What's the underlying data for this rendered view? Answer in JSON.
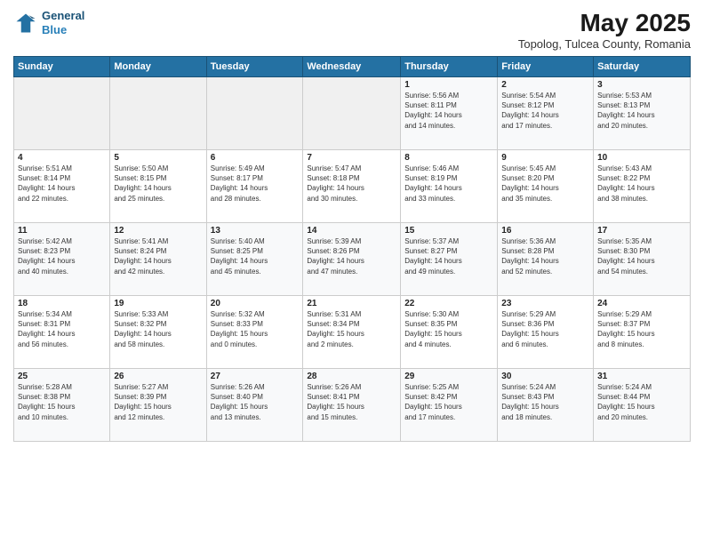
{
  "header": {
    "logo_line1": "General",
    "logo_line2": "Blue",
    "title": "May 2025",
    "subtitle": "Topolog, Tulcea County, Romania"
  },
  "weekdays": [
    "Sunday",
    "Monday",
    "Tuesday",
    "Wednesday",
    "Thursday",
    "Friday",
    "Saturday"
  ],
  "weeks": [
    [
      {
        "day": "",
        "info": ""
      },
      {
        "day": "",
        "info": ""
      },
      {
        "day": "",
        "info": ""
      },
      {
        "day": "",
        "info": ""
      },
      {
        "day": "1",
        "info": "Sunrise: 5:56 AM\nSunset: 8:11 PM\nDaylight: 14 hours\nand 14 minutes."
      },
      {
        "day": "2",
        "info": "Sunrise: 5:54 AM\nSunset: 8:12 PM\nDaylight: 14 hours\nand 17 minutes."
      },
      {
        "day": "3",
        "info": "Sunrise: 5:53 AM\nSunset: 8:13 PM\nDaylight: 14 hours\nand 20 minutes."
      }
    ],
    [
      {
        "day": "4",
        "info": "Sunrise: 5:51 AM\nSunset: 8:14 PM\nDaylight: 14 hours\nand 22 minutes."
      },
      {
        "day": "5",
        "info": "Sunrise: 5:50 AM\nSunset: 8:15 PM\nDaylight: 14 hours\nand 25 minutes."
      },
      {
        "day": "6",
        "info": "Sunrise: 5:49 AM\nSunset: 8:17 PM\nDaylight: 14 hours\nand 28 minutes."
      },
      {
        "day": "7",
        "info": "Sunrise: 5:47 AM\nSunset: 8:18 PM\nDaylight: 14 hours\nand 30 minutes."
      },
      {
        "day": "8",
        "info": "Sunrise: 5:46 AM\nSunset: 8:19 PM\nDaylight: 14 hours\nand 33 minutes."
      },
      {
        "day": "9",
        "info": "Sunrise: 5:45 AM\nSunset: 8:20 PM\nDaylight: 14 hours\nand 35 minutes."
      },
      {
        "day": "10",
        "info": "Sunrise: 5:43 AM\nSunset: 8:22 PM\nDaylight: 14 hours\nand 38 minutes."
      }
    ],
    [
      {
        "day": "11",
        "info": "Sunrise: 5:42 AM\nSunset: 8:23 PM\nDaylight: 14 hours\nand 40 minutes."
      },
      {
        "day": "12",
        "info": "Sunrise: 5:41 AM\nSunset: 8:24 PM\nDaylight: 14 hours\nand 42 minutes."
      },
      {
        "day": "13",
        "info": "Sunrise: 5:40 AM\nSunset: 8:25 PM\nDaylight: 14 hours\nand 45 minutes."
      },
      {
        "day": "14",
        "info": "Sunrise: 5:39 AM\nSunset: 8:26 PM\nDaylight: 14 hours\nand 47 minutes."
      },
      {
        "day": "15",
        "info": "Sunrise: 5:37 AM\nSunset: 8:27 PM\nDaylight: 14 hours\nand 49 minutes."
      },
      {
        "day": "16",
        "info": "Sunrise: 5:36 AM\nSunset: 8:28 PM\nDaylight: 14 hours\nand 52 minutes."
      },
      {
        "day": "17",
        "info": "Sunrise: 5:35 AM\nSunset: 8:30 PM\nDaylight: 14 hours\nand 54 minutes."
      }
    ],
    [
      {
        "day": "18",
        "info": "Sunrise: 5:34 AM\nSunset: 8:31 PM\nDaylight: 14 hours\nand 56 minutes."
      },
      {
        "day": "19",
        "info": "Sunrise: 5:33 AM\nSunset: 8:32 PM\nDaylight: 14 hours\nand 58 minutes."
      },
      {
        "day": "20",
        "info": "Sunrise: 5:32 AM\nSunset: 8:33 PM\nDaylight: 15 hours\nand 0 minutes."
      },
      {
        "day": "21",
        "info": "Sunrise: 5:31 AM\nSunset: 8:34 PM\nDaylight: 15 hours\nand 2 minutes."
      },
      {
        "day": "22",
        "info": "Sunrise: 5:30 AM\nSunset: 8:35 PM\nDaylight: 15 hours\nand 4 minutes."
      },
      {
        "day": "23",
        "info": "Sunrise: 5:29 AM\nSunset: 8:36 PM\nDaylight: 15 hours\nand 6 minutes."
      },
      {
        "day": "24",
        "info": "Sunrise: 5:29 AM\nSunset: 8:37 PM\nDaylight: 15 hours\nand 8 minutes."
      }
    ],
    [
      {
        "day": "25",
        "info": "Sunrise: 5:28 AM\nSunset: 8:38 PM\nDaylight: 15 hours\nand 10 minutes."
      },
      {
        "day": "26",
        "info": "Sunrise: 5:27 AM\nSunset: 8:39 PM\nDaylight: 15 hours\nand 12 minutes."
      },
      {
        "day": "27",
        "info": "Sunrise: 5:26 AM\nSunset: 8:40 PM\nDaylight: 15 hours\nand 13 minutes."
      },
      {
        "day": "28",
        "info": "Sunrise: 5:26 AM\nSunset: 8:41 PM\nDaylight: 15 hours\nand 15 minutes."
      },
      {
        "day": "29",
        "info": "Sunrise: 5:25 AM\nSunset: 8:42 PM\nDaylight: 15 hours\nand 17 minutes."
      },
      {
        "day": "30",
        "info": "Sunrise: 5:24 AM\nSunset: 8:43 PM\nDaylight: 15 hours\nand 18 minutes."
      },
      {
        "day": "31",
        "info": "Sunrise: 5:24 AM\nSunset: 8:44 PM\nDaylight: 15 hours\nand 20 minutes."
      }
    ]
  ]
}
